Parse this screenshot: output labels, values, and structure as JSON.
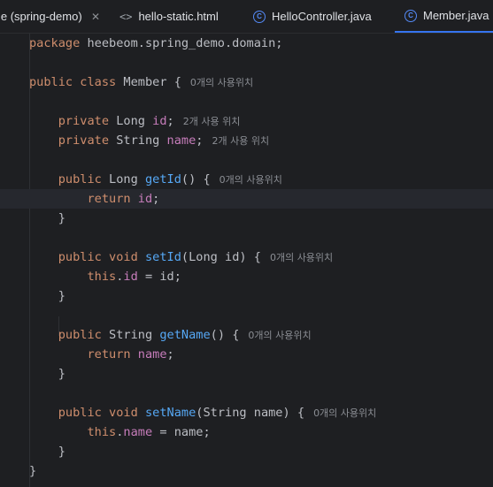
{
  "tabs": [
    {
      "label": "le (spring-demo)",
      "close": "✕"
    },
    {
      "icon": "<>",
      "label": "hello-static.html"
    },
    {
      "icon": "C",
      "label": "HelloController.java"
    },
    {
      "icon": "C",
      "label": "Member.java",
      "active": true
    }
  ],
  "code": {
    "package_kw": "package",
    "package_name": "heebeom.spring_demo.domain;",
    "class_decl": {
      "public": "public",
      "class": "class",
      "name": "Member",
      "brace": "{",
      "hint": "0개의 사용위치"
    },
    "field_id": {
      "mod": "private",
      "type": "Long",
      "name": "id",
      "semi": ";",
      "hint": "2개 사용 위치"
    },
    "field_name": {
      "mod": "private",
      "type": "String",
      "name": "name",
      "semi": ";",
      "hint": "2개 사용 위치"
    },
    "get_id": {
      "mod": "public",
      "type": "Long",
      "name": "getId",
      "params": "()",
      "brace": "{",
      "hint": "0개의 사용위치",
      "body_kw": "return",
      "body_field": "id",
      "body_end": ";"
    },
    "set_id": {
      "mod": "public",
      "type": "void",
      "name": "setId",
      "params": "(Long id)",
      "brace": "{",
      "hint": "0개의 사용위치",
      "body_this": "this",
      "body_field": "id",
      "body_rest": " = id;"
    },
    "get_name": {
      "mod": "public",
      "type": "String",
      "name": "getName",
      "params": "()",
      "brace": "{",
      "hint": "0개의 사용위치",
      "body_kw": "return",
      "body_field": "name",
      "body_end": ";"
    },
    "set_name": {
      "mod": "public",
      "type": "void",
      "name": "setName",
      "params": "(String name)",
      "brace": "{",
      "hint": "0개의 사용위치",
      "body_this": "this",
      "body_field": "name",
      "body_rest": " = name;"
    },
    "close_brace": "}"
  },
  "icons": {
    "intention": "lightbulb-icon",
    "file": "java-class-icon"
  },
  "colors": {
    "background": "#1e1f22",
    "keyword": "#cf8e6d",
    "field": "#c77dbb",
    "method": "#56a8f5",
    "text": "#bcbec4",
    "hint": "#8b8e94",
    "active_tab": "#3574f0"
  }
}
